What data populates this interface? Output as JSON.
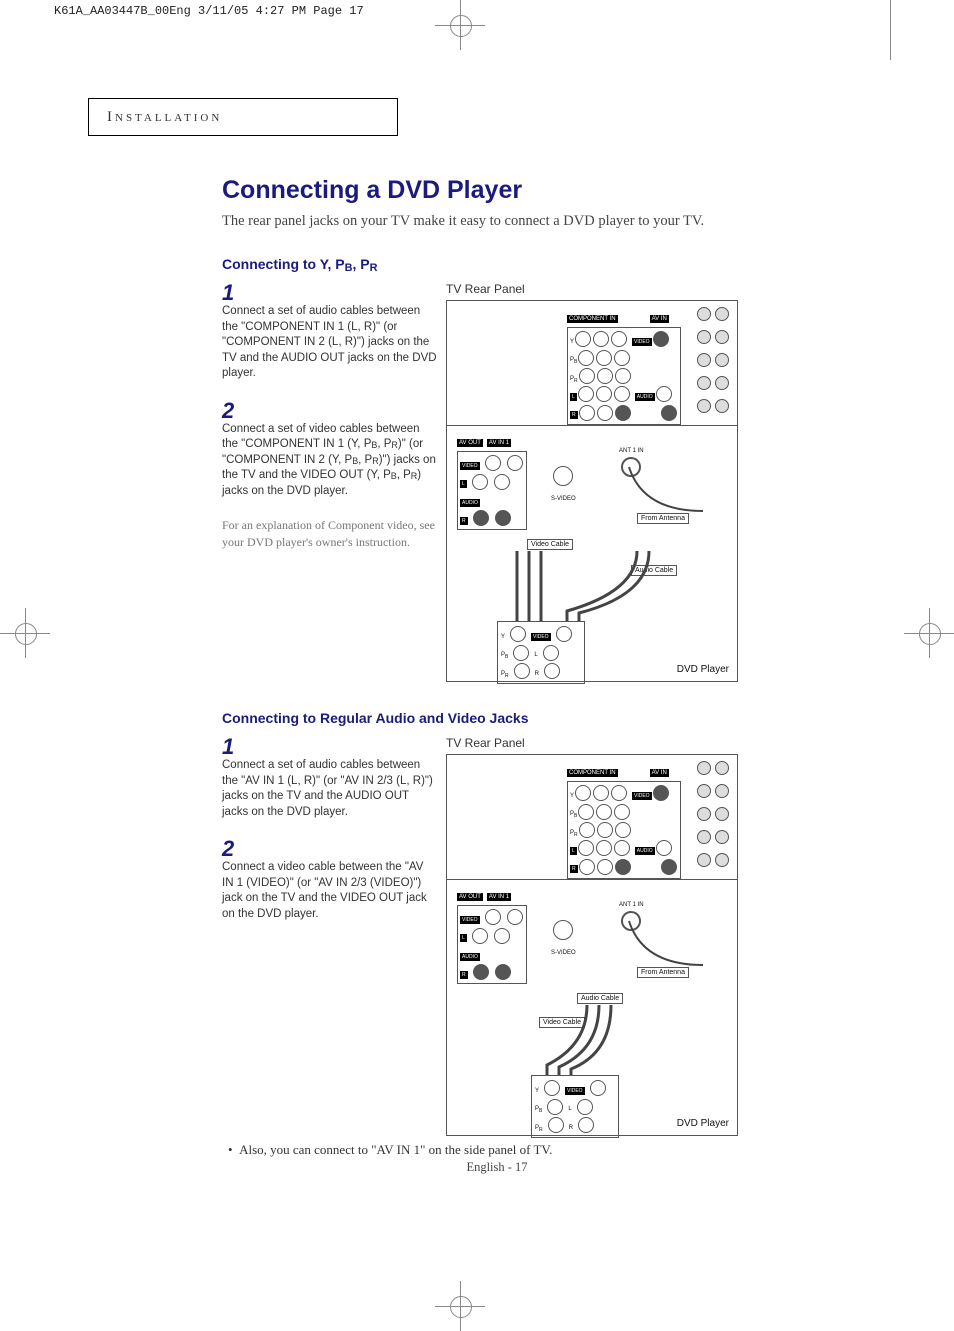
{
  "print_header": "K61A_AA03447B_00Eng  3/11/05  4:27 PM  Page 17",
  "section_label": "Installation",
  "title": "Connecting a DVD Player",
  "intro": "The rear panel jacks on your TV make it easy to connect a DVD player to your TV.",
  "sec1": {
    "heading": "Connecting to Y, PB, PR",
    "diag_label": "TV Rear Panel",
    "steps": [
      {
        "num": "1",
        "text": "Connect a set of audio cables between the \"COMPONENT IN 1 (L, R)\" (or \"COMPONENT IN 2 (L, R)\") jacks on the TV and the AUDIO OUT jacks on the DVD player."
      },
      {
        "num": "2",
        "text": "Connect a set of video cables between the \"COMPONENT IN 1 (Y, PB, PR)\" (or \"COMPONENT IN 2 (Y, PB, PR)\") jacks on the TV and the VIDEO OUT (Y, PB, PR) jacks on the DVD player."
      }
    ],
    "note": "For an explanation of Component video, see your DVD player's owner's instruction.",
    "diag": {
      "component_in": "COMPONENT IN",
      "av_in": "AV IN",
      "video": "VIDEO",
      "audio": "AUDIO",
      "l": "L",
      "r": "R",
      "av_out": "AV OUT",
      "av_in1": "AV IN 1",
      "svideo": "S-VIDEO",
      "ant1": "ANT 1 IN",
      "from_ant": "From Antenna",
      "video_cable": "Video Cable",
      "audio_cable": "Audio Cable",
      "dvd": "DVD Player",
      "y": "Y",
      "pb": "PB",
      "pr": "PR"
    }
  },
  "sec2": {
    "heading": "Connecting to Regular Audio and Video Jacks",
    "diag_label": "TV Rear Panel",
    "steps": [
      {
        "num": "1",
        "text": "Connect a set of audio cables between the \"AV IN 1 (L, R)\" (or \"AV IN 2/3 (L, R)\") jacks on the TV and the AUDIO OUT jacks on the DVD player."
      },
      {
        "num": "2",
        "text": "Connect a video cable between the \"AV IN 1 (VIDEO)\" (or \"AV IN 2/3 (VIDEO)\") jack on the TV and the VIDEO OUT jack on the DVD player."
      }
    ],
    "diag": {
      "component_in": "COMPONENT IN",
      "av_in": "AV IN",
      "video": "VIDEO",
      "audio": "AUDIO",
      "l": "L",
      "r": "R",
      "av_out": "AV OUT",
      "av_in1": "AV IN 1",
      "svideo": "S-VIDEO",
      "ant1": "ANT 1 IN",
      "from_ant": "From Antenna",
      "video_cable": "Video Cable",
      "audio_cable": "Audio Cable",
      "dvd": "DVD Player",
      "y": "Y",
      "pb": "PB",
      "pr": "PR"
    }
  },
  "bullet_note": "Also, you can connect to \"AV IN 1\" on the side panel of TV.",
  "footer": "English - 17"
}
